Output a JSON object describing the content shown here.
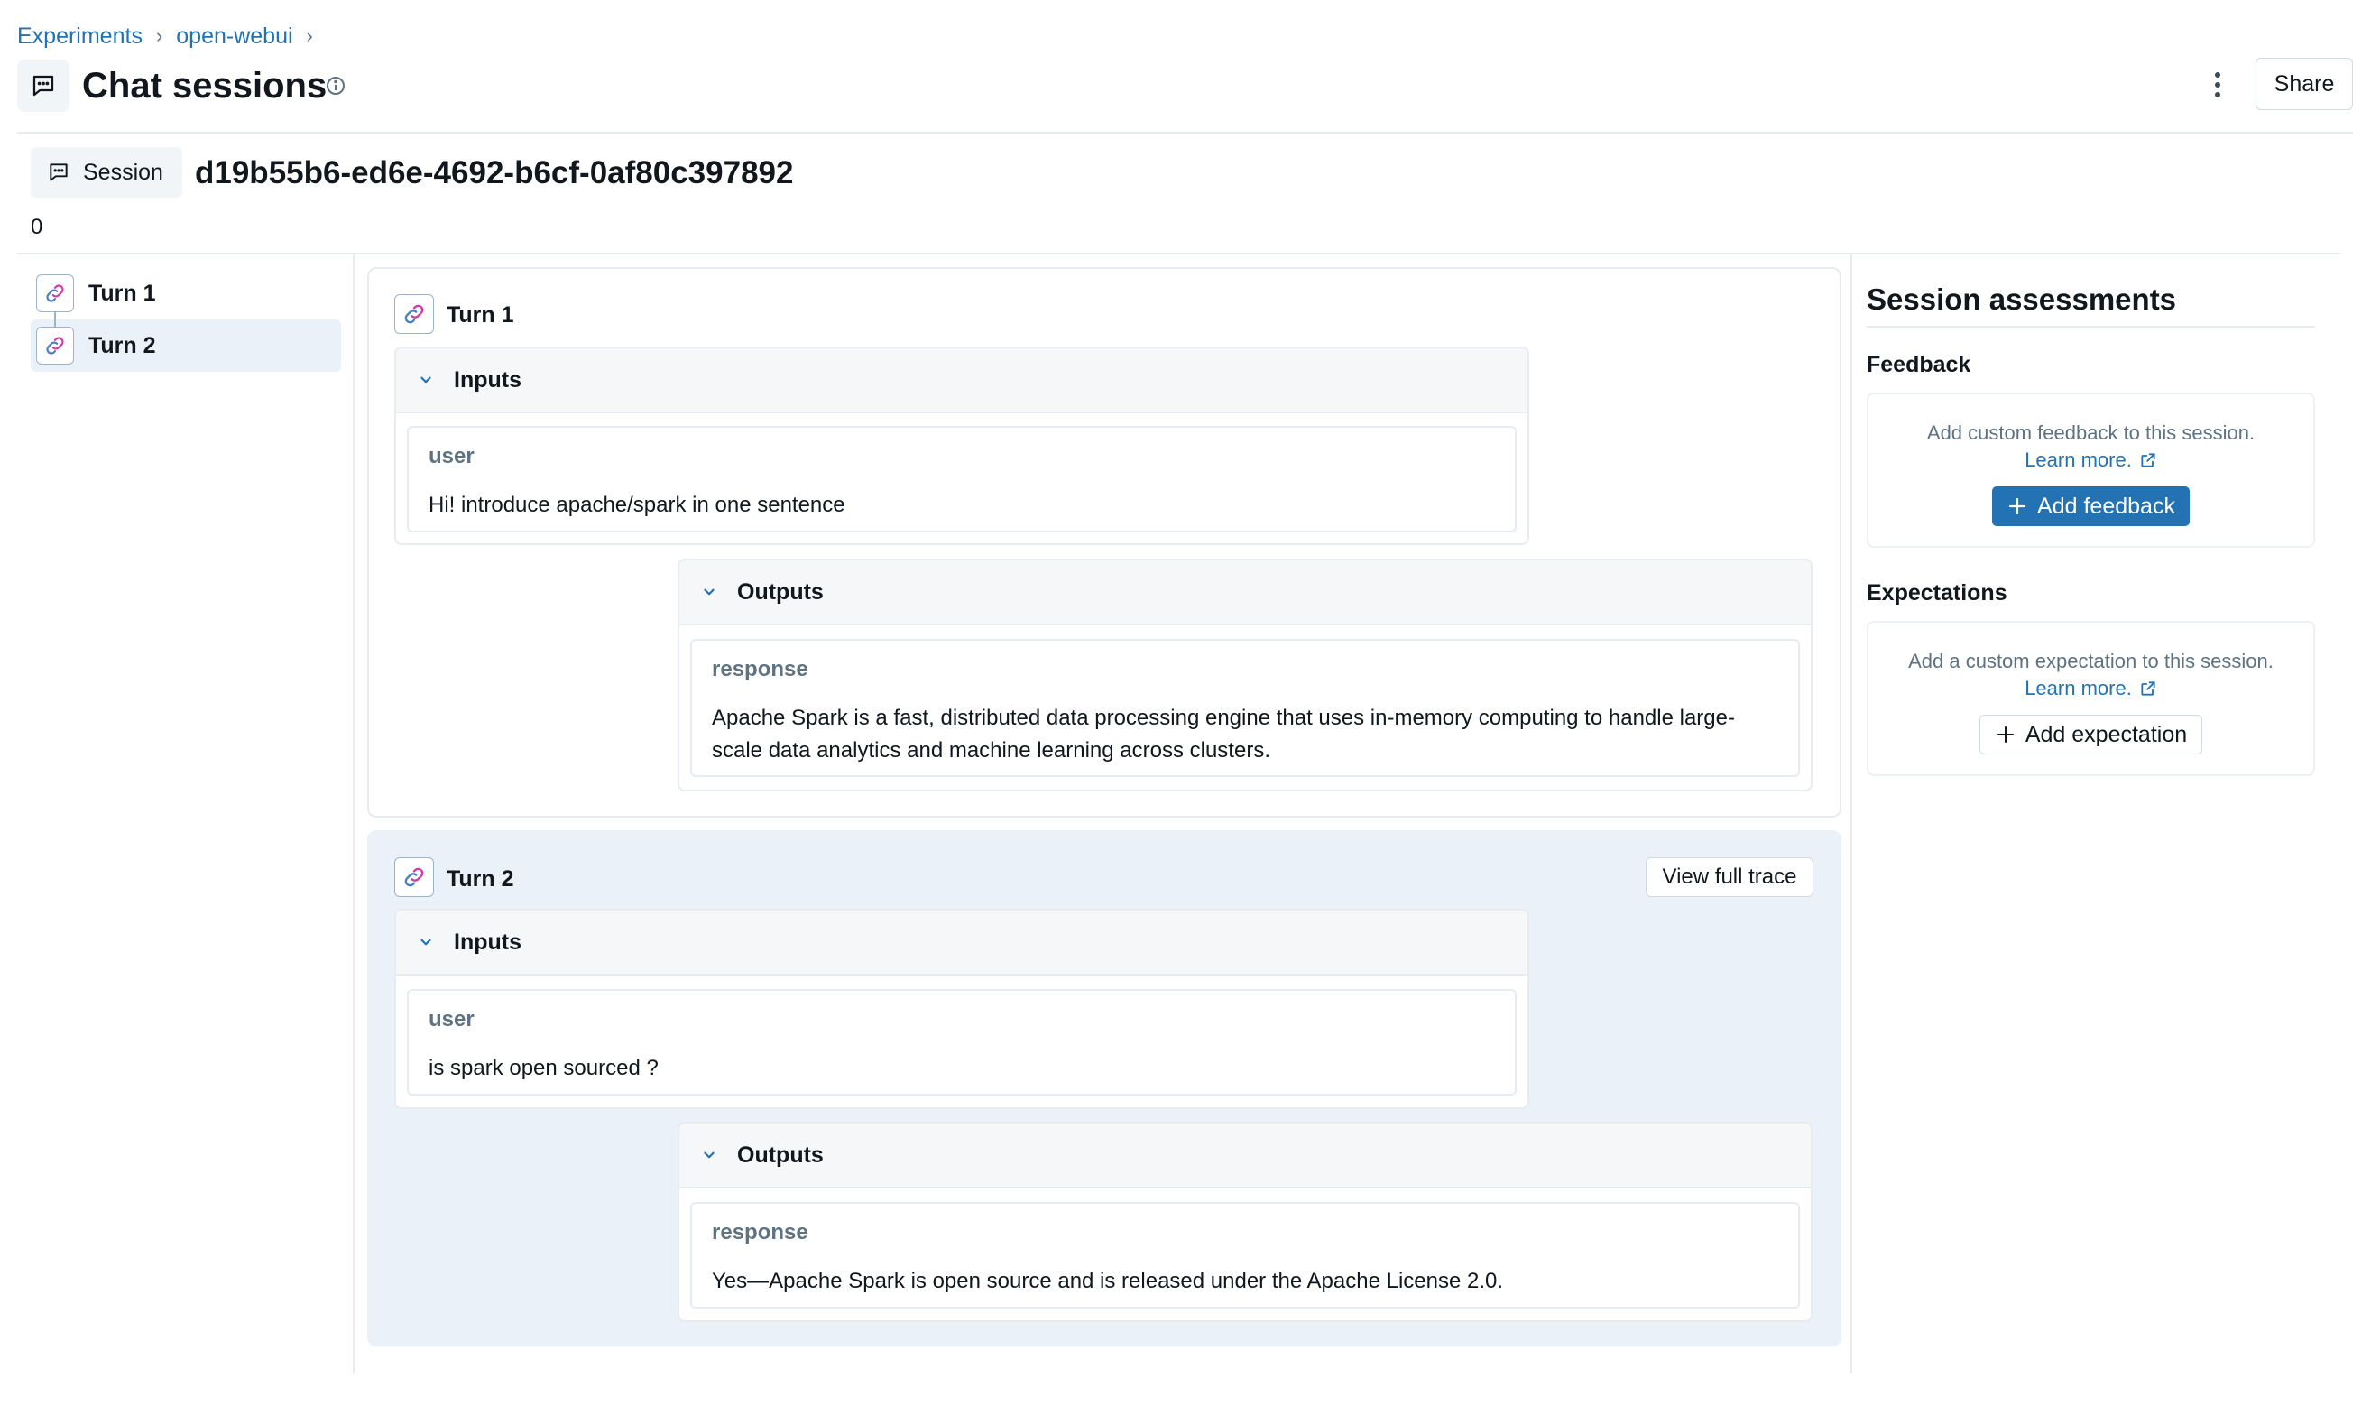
{
  "breadcrumb": {
    "items": [
      "Experiments",
      "open-webui"
    ],
    "separator": "›"
  },
  "header": {
    "title": "Chat sessions",
    "share_label": "Share"
  },
  "session": {
    "tag_label": "Session",
    "id": "d19b55b6-ed6e-4692-b6cf-0af80c397892",
    "count": "0"
  },
  "nav": {
    "items": [
      {
        "label": "Turn 1",
        "active": false
      },
      {
        "label": "Turn 2",
        "active": true
      }
    ]
  },
  "turns": [
    {
      "title": "Turn 1",
      "inputs": {
        "header": "Inputs",
        "role": "user",
        "text": "Hi! introduce apache/spark in one sentence"
      },
      "outputs": {
        "header": "Outputs",
        "role": "response",
        "text_line1": "Apache Spark is a fast, distributed data processing engine that uses in-memory computing to handle large-",
        "text_line2": "scale data analytics and machine learning across clusters."
      }
    },
    {
      "title": "Turn 2",
      "view_trace_label": "View full trace",
      "inputs": {
        "header": "Inputs",
        "role": "user",
        "text": "is spark open sourced ?"
      },
      "outputs": {
        "header": "Outputs",
        "role": "response",
        "text": "Yes—Apache Spark is open source and is released under the Apache License 2.0."
      }
    }
  ],
  "assessments": {
    "title": "Session assessments",
    "feedback": {
      "title": "Feedback",
      "desc": "Add custom feedback to this session.",
      "learn_more": "Learn more.",
      "button": "Add feedback"
    },
    "expectations": {
      "title": "Expectations",
      "desc": "Add a custom expectation to this session.",
      "learn_more": "Learn more.",
      "button": "Add expectation"
    }
  },
  "colors": {
    "accent": "#2272b4",
    "active_bg": "#eaf1f8",
    "icon_pink": "#d33aa8",
    "icon_blue": "#4a7fc1"
  },
  "icons": [
    "chat-bubble-icon",
    "info-icon",
    "kebab-icon",
    "link-icon",
    "chevron-down-icon",
    "external-link-icon",
    "plus-icon"
  ]
}
